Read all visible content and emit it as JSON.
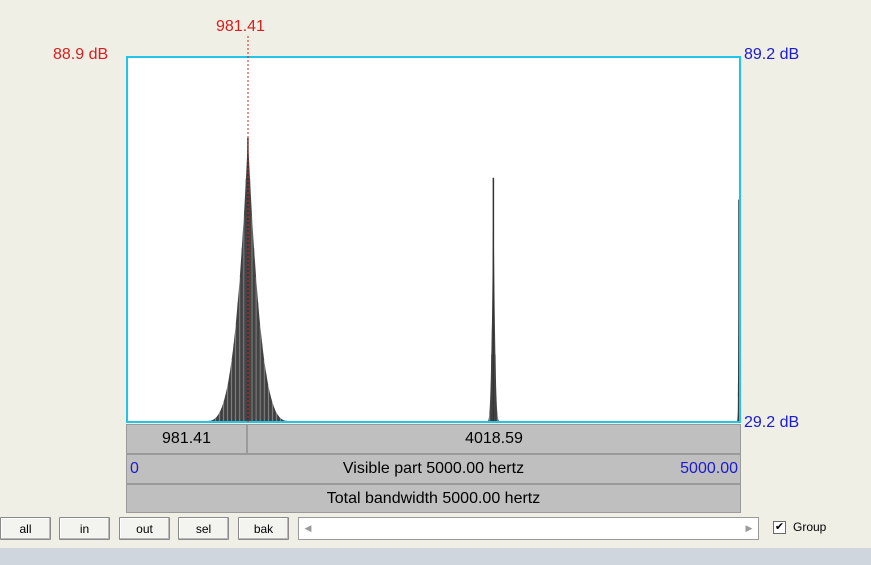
{
  "cursor": {
    "frequency_label": "981.41"
  },
  "levels": {
    "top_left": "88.9 dB",
    "top_right": "89.2 dB",
    "bottom_right": "29.2 dB"
  },
  "spectrum": {
    "peaks": [
      {
        "freq_hz": 981.41,
        "height": 0.78,
        "width_hz": 700
      },
      {
        "freq_hz": 2990,
        "height": 0.67,
        "width_hz": 100
      },
      {
        "freq_hz": 5000,
        "height": 0.61,
        "width_hz": 40
      }
    ]
  },
  "selection_bar": {
    "left_value": "981.41",
    "right_value": "4018.59"
  },
  "visible_bar": {
    "start": "0",
    "label": "Visible part 5000.00 hertz",
    "end": "5000.00"
  },
  "total_bar": {
    "label": "Total bandwidth 5000.00 hertz"
  },
  "buttons": {
    "all": "all",
    "in": "in",
    "out": "out",
    "sel": "sel",
    "bak": "bak"
  },
  "group": {
    "label": "Group",
    "checked": true
  },
  "colors": {
    "cursor": "#d42020",
    "right_scale": "#1a1ad0",
    "frame": "#22c4e8",
    "spectrum": "#333333"
  }
}
